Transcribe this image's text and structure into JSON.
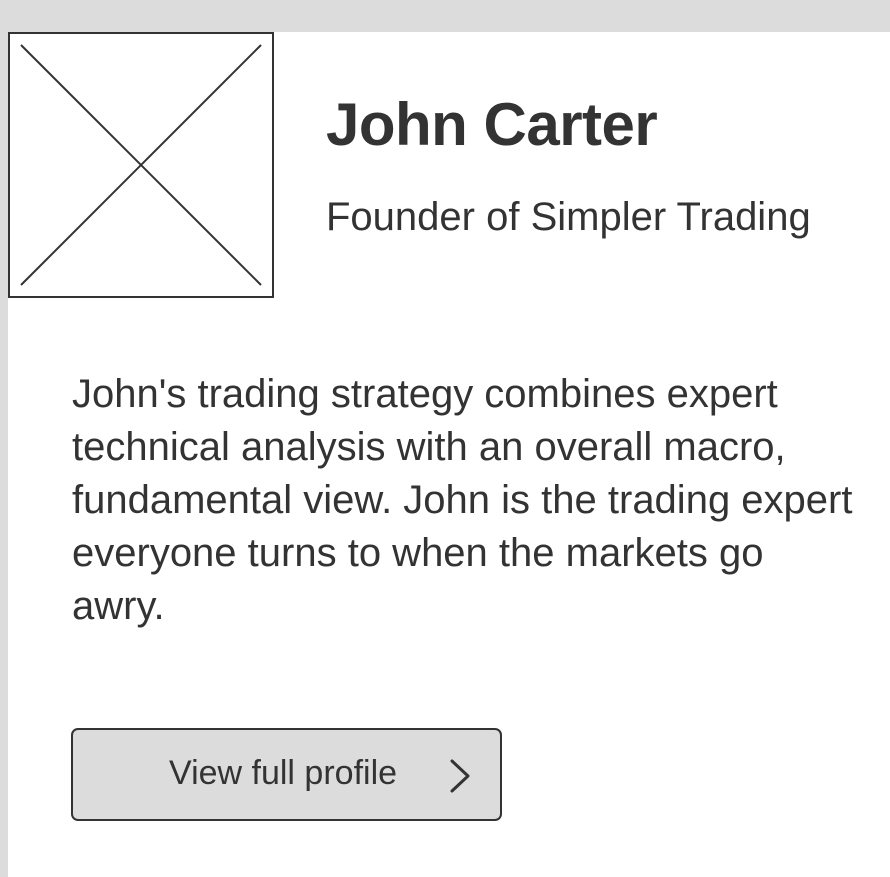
{
  "profile": {
    "name": "John Carter",
    "title": "Founder of Simpler Trading",
    "bio": "John's trading strategy combines expert technical analysis with an overall macro, fundamental view. John is the trading expert everyone turns to when the markets go awry.",
    "avatar_icon": "image-placeholder-icon"
  },
  "actions": {
    "view_profile_label": "View full profile",
    "view_profile_icon": "chevron-right-icon"
  },
  "colors": {
    "page_bg": "#dcdcdc",
    "card_bg": "#ffffff",
    "text": "#333333",
    "button_bg": "#dcdcdc",
    "border": "#333333"
  }
}
